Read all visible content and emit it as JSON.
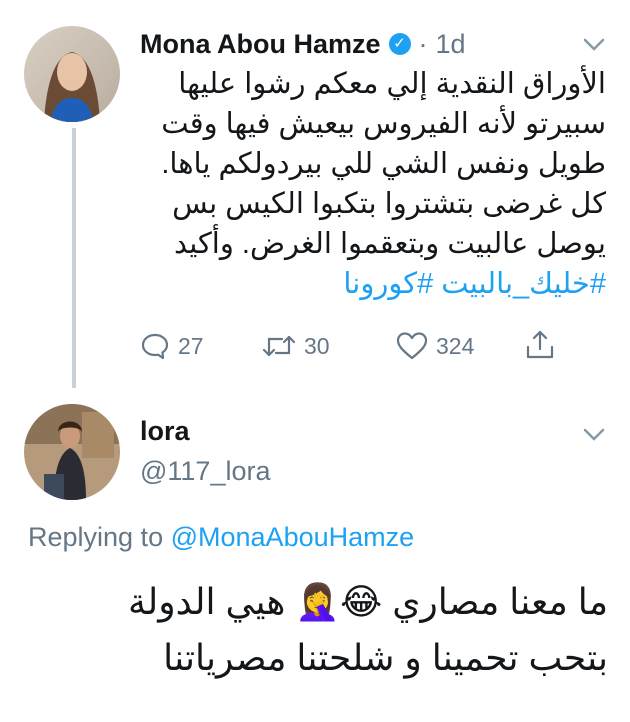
{
  "tweet": {
    "author_name": "Mona Abou Hamze",
    "time_sep": "·",
    "time": "1d",
    "text_lines": [
      "الأوراق النقدية إلي معكم رشوا عليها",
      "سبيرتو لأنه الفيروس بيعيش فيها وقت",
      "طويل ونفس الشي للي بيردولكم ياها.",
      "كل غرضى بتشتروا بتكبوا الكيس بس",
      "يوصل عالبيت وبتعقموا الغرض. وأكيد"
    ],
    "hashtags": "#خليك_بالبيت #كورونا",
    "actions": {
      "reply_count": "27",
      "retweet_count": "30",
      "like_count": "324"
    },
    "icons": {
      "reply": "reply-icon",
      "retweet": "retweet-icon",
      "like": "heart-icon",
      "share": "share-icon",
      "menu": "chevron-down-icon",
      "verified": "verified-badge-icon"
    }
  },
  "reply": {
    "author_name": "lora",
    "handle": "@117_lora",
    "replying_label": "Replying to",
    "replying_to": "@MonaAbouHamze",
    "text_line1": "ما معنا مصاري 😂🤦‍♀️ هيي الدولة",
    "text_line2": "بتحب تحمينا و شلحتنا مصرياتنا"
  },
  "colors": {
    "accent": "#1da1f2",
    "muted": "#657786",
    "text": "#14171a",
    "thread_line": "#c9d1d8"
  }
}
